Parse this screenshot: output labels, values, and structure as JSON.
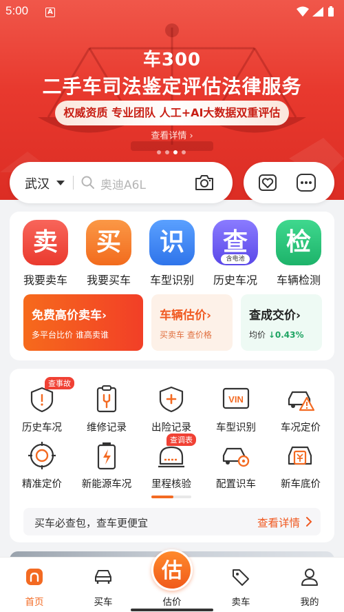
{
  "status_bar": {
    "time": "5:00",
    "notification": "A"
  },
  "banner": {
    "title": "车300",
    "subtitle": "二手车司法鉴定评估法律服务",
    "pill": "权威资质 专业团队 人工+AI大数据双重评估",
    "detail": "查看详情",
    "detail_arrow": "›",
    "slides": 4,
    "active_slide": 3,
    "color": "#e8392e"
  },
  "search": {
    "city": "武汉",
    "placeholder": "奥迪A6L"
  },
  "main_services": [
    {
      "label": "我要卖车",
      "glyph": "卖",
      "color": "#f04a3c",
      "icon": "sell-icon"
    },
    {
      "label": "我要买车",
      "glyph": "买",
      "color": "#f77e2a",
      "icon": "buy-icon"
    },
    {
      "label": "车型识别",
      "glyph": "识",
      "color": "#3b82f0",
      "icon": "identify-icon"
    },
    {
      "label": "历史车况",
      "glyph": "查",
      "color": "#6f5cf0",
      "icon": "history-icon",
      "badge": "含电池"
    },
    {
      "label": "车辆检测",
      "glyph": "检",
      "color": "#27c07a",
      "icon": "inspect-icon"
    }
  ],
  "promos": [
    {
      "title": "免费高价卖车",
      "arrow": "›",
      "subtitle": "多平台比价 谁高卖谁"
    },
    {
      "title": "车辆估价",
      "arrow": "›",
      "subtitle": "买卖车 查价格"
    },
    {
      "title": "查成交价",
      "arrow": "›",
      "subtitle_prefix": "均价",
      "trend": "↓0.43%"
    }
  ],
  "services": [
    {
      "label": "历史车况",
      "icon": "shield-alert-icon",
      "tag": "查事故"
    },
    {
      "label": "维修记录",
      "icon": "wrench-clipboard-icon"
    },
    {
      "label": "出险记录",
      "icon": "shield-plus-icon"
    },
    {
      "label": "车型识别",
      "icon": "vin-icon",
      "icon_text": "VIN"
    },
    {
      "label": "车况定价",
      "icon": "car-warning-icon"
    },
    {
      "label": "精准定价",
      "icon": "target-icon"
    },
    {
      "label": "新能源车况",
      "icon": "battery-icon"
    },
    {
      "label": "里程核验",
      "icon": "odometer-icon",
      "tag": "查调表"
    },
    {
      "label": "配置识车",
      "icon": "car-gear-icon"
    },
    {
      "label": "新车底价",
      "icon": "car-price-icon"
    }
  ],
  "notice": {
    "text": "买车必查包，查车更便宜",
    "link": "查看详情"
  },
  "tabbar": {
    "tabs": [
      {
        "label": "首页",
        "icon": "home-icon",
        "active": true
      },
      {
        "label": "买车",
        "icon": "car-icon",
        "active": false
      },
      {
        "label": "估价",
        "icon": "estimate-icon",
        "active": false,
        "glyph": "估"
      },
      {
        "label": "卖车",
        "icon": "tag-icon",
        "active": false
      },
      {
        "label": "我的",
        "icon": "profile-icon",
        "active": false
      }
    ],
    "accent": "#f36a22"
  }
}
